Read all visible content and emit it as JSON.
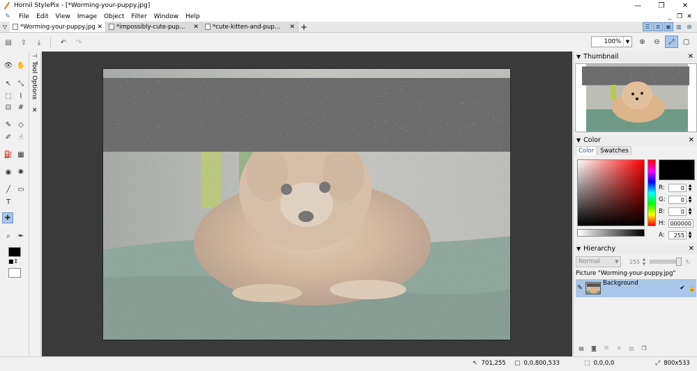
{
  "window": {
    "title": "Hornil StylePix - [*Worming-your-puppy.jpg]",
    "controls": {
      "minimize": "—",
      "maximize": "❐",
      "close": "✕"
    }
  },
  "menu": {
    "items": [
      "File",
      "Edit",
      "View",
      "Image",
      "Object",
      "Filter",
      "Window",
      "Help"
    ],
    "mdi": {
      "minimize": "_",
      "restore": "❐",
      "close": "✕"
    }
  },
  "tabs": {
    "items": [
      {
        "label": "*Worming-your-puppy.jpg",
        "close": "✕"
      },
      {
        "label": "*impossibly-cute-pup...",
        "close": "✕"
      },
      {
        "label": "*cute-kitten-and-pup...",
        "close": "✕"
      }
    ],
    "add": "+"
  },
  "toolbar": {
    "zoom_value": "100%"
  },
  "tool_options": {
    "label": "Tool Options"
  },
  "panels": {
    "thumbnail": {
      "title": "Thumbnail"
    },
    "color": {
      "title": "Color",
      "tabs": [
        "Color",
        "Swatches"
      ],
      "channels": {
        "r": {
          "label": "R:",
          "value": "0"
        },
        "g": {
          "label": "G:",
          "value": "0"
        },
        "b": {
          "label": "B:",
          "value": "0"
        },
        "h": {
          "label": "H:",
          "value": "000000"
        },
        "a": {
          "label": "A:",
          "value": "255"
        }
      },
      "current_color": "#000000"
    },
    "hierarchy": {
      "title": "Hierarchy",
      "blend_mode": "Normal",
      "opacity": "255",
      "picture_label": "Picture \"Worming-your-puppy.jpg\"",
      "layer_name": "Background"
    }
  },
  "statusbar": {
    "cursor": "701,255",
    "selection": "0,0,800,533",
    "object": "0,0,0,0",
    "size": "800x533"
  }
}
